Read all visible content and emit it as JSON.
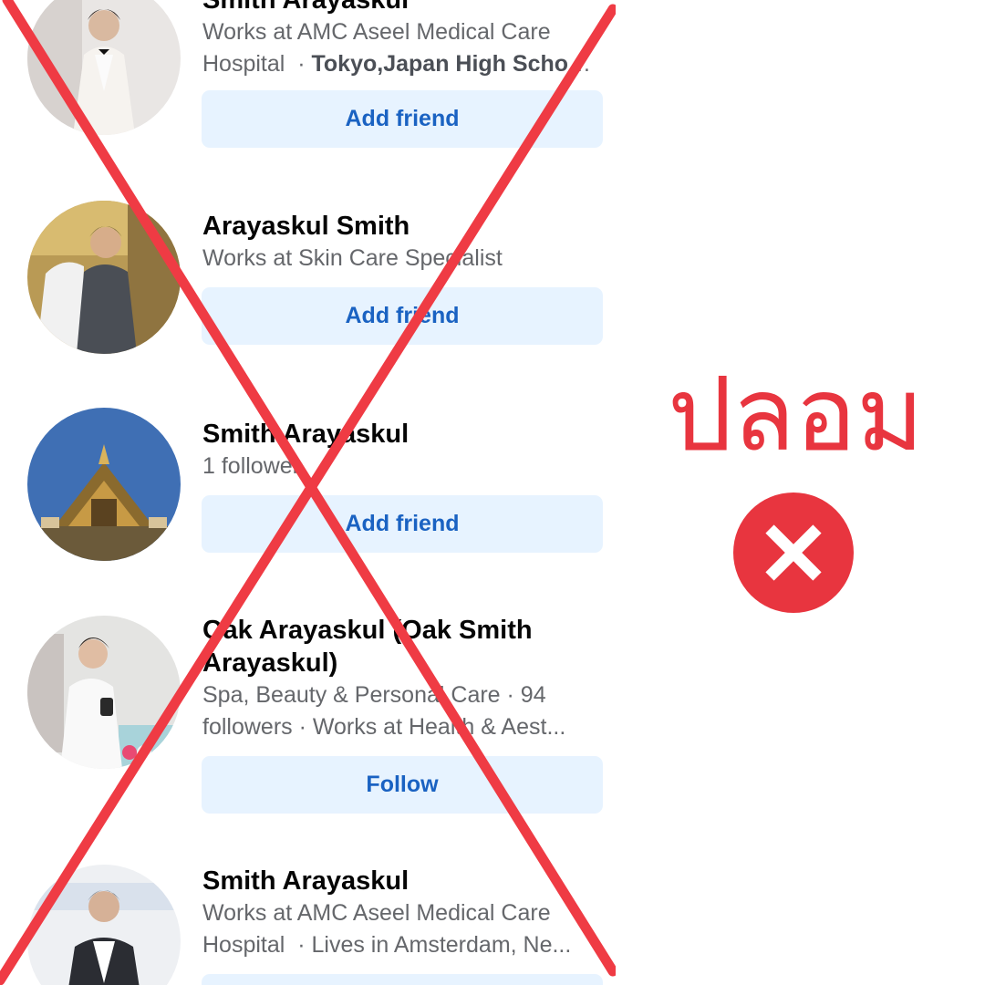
{
  "results": [
    {
      "name": "Smith Arayaskul",
      "line1": "Works at AMC Aseel Medical Care",
      "line2": "Hospital",
      "line2_suffix": "Tokyo,Japan High School...",
      "button": "Add friend"
    },
    {
      "name": "Arayaskul Smith",
      "line1": "Works at Skin Care Specialist",
      "button": "Add friend"
    },
    {
      "name": "Smith Arayaskul",
      "line1": "1 follower",
      "button": "Add friend"
    },
    {
      "name": "Oak Arayaskul (Oak Smith",
      "name2": "Arayaskul)",
      "line1": "Spa, Beauty & Personal Care · 94",
      "line2": "followers · Works at Health & Aest...",
      "button": "Follow"
    },
    {
      "name": "Smith Arayaskul",
      "line1": "Works at AMC Aseel Medical Care",
      "line2": "Hospital",
      "line2_suffix": "Lives in Amsterdam, Ne..."
    }
  ],
  "verdict": {
    "label": "ปลอม",
    "icon": "close-circle-icon",
    "color": "#e8353f"
  },
  "cross_overlay": {
    "icon": "red-x-cross-icon",
    "color": "#ef3b44"
  }
}
